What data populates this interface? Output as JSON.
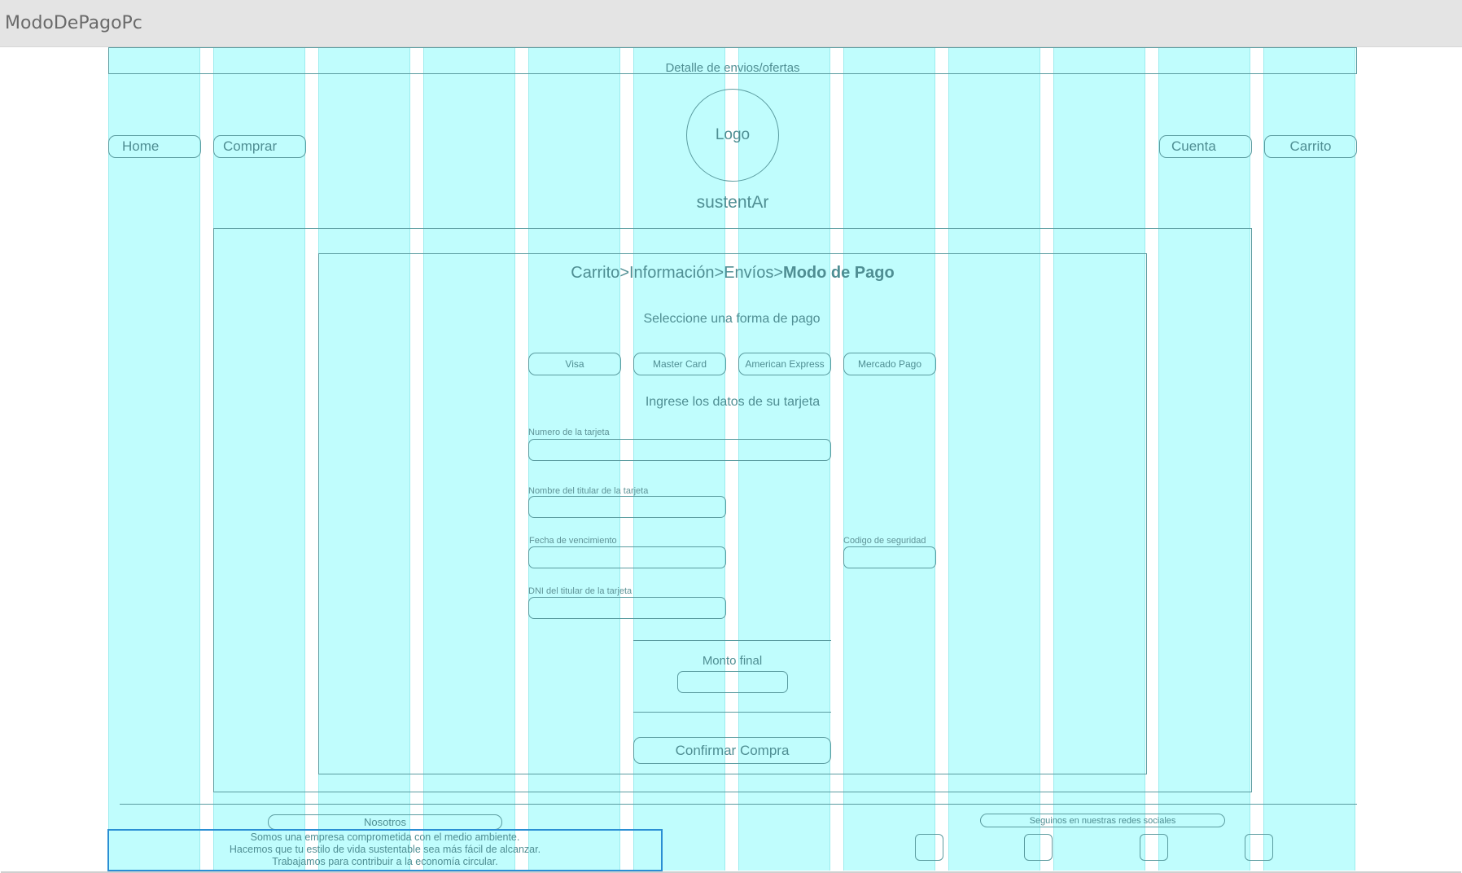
{
  "window": {
    "title": "ModoDePagoPc"
  },
  "banner": {
    "text": "Detalle de envios/ofertas"
  },
  "header": {
    "nav_left": [
      "Home",
      "Comprar"
    ],
    "logo_label": "Logo",
    "brand": "sustentAr",
    "nav_right": [
      "Cuenta",
      "Carrito"
    ]
  },
  "checkout": {
    "breadcrumb": {
      "steps": [
        "Carrito",
        ">",
        "Información",
        ">",
        "Envíos",
        ">"
      ],
      "current": "Modo de Pago"
    },
    "payment_prompt": "Seleccione una forma de pago",
    "payment_methods": [
      "Visa",
      "Master Card",
      "American Express",
      "Mercado Pago"
    ],
    "card_prompt": "Ingrese los datos de su tarjeta",
    "fields": {
      "card_number": {
        "label": "Numero de la tarjeta",
        "value": ""
      },
      "holder_name": {
        "label": "Nombre del titular de la tarjeta",
        "value": ""
      },
      "expiry": {
        "label": "Fecha de vencimiento",
        "value": ""
      },
      "security_code": {
        "label": "Codigo de seguridad",
        "value": ""
      },
      "holder_dni": {
        "label": "DNI del titular de la tarjeta",
        "value": ""
      }
    },
    "total_label": "Monto final",
    "total_value": "",
    "confirm_label": "Confirmar Compra"
  },
  "footer": {
    "about_label": "Nosotros",
    "about_lines": [
      "Somos una empresa comprometida con el medio ambiente.",
      "Hacemos que tu estilo de vida sustentable sea más fácil de alcanzar.",
      "Trabajamos para contribuir a la economía circular."
    ],
    "social_label": "Seguinos en nuestras redes sociales",
    "social_icons": [
      "social-icon-1",
      "social-icon-2",
      "social-icon-3",
      "social-icon-4"
    ]
  },
  "colors": {
    "grid_column": "#c0fdfd",
    "wire_line": "#5b9ca0",
    "text": "#4f8e93",
    "selection": "#2a8ed4",
    "titlebar": "#e4e4e4"
  }
}
